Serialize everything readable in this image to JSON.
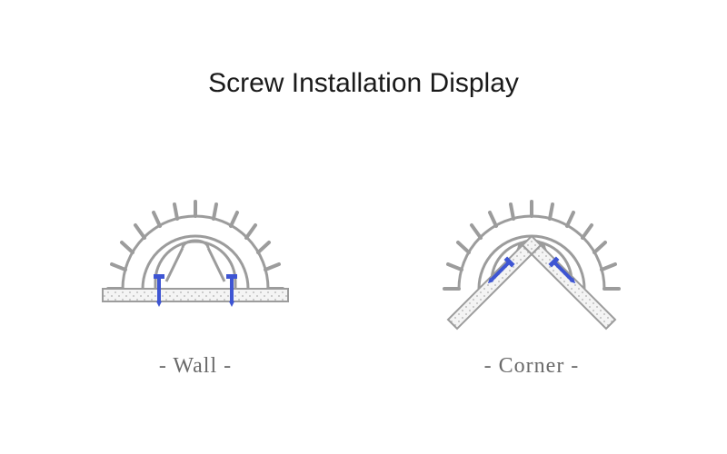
{
  "title": "Screw Installation Display",
  "panels": [
    {
      "caption": "-  Wall  -"
    },
    {
      "caption": "-   Corner   -"
    }
  ],
  "colors": {
    "stroke": "#9c9c9c",
    "title": "#1a1a1a",
    "caption": "#6a6a6a",
    "screw": "#3e55d3",
    "hatch": "#b0b0b0"
  }
}
